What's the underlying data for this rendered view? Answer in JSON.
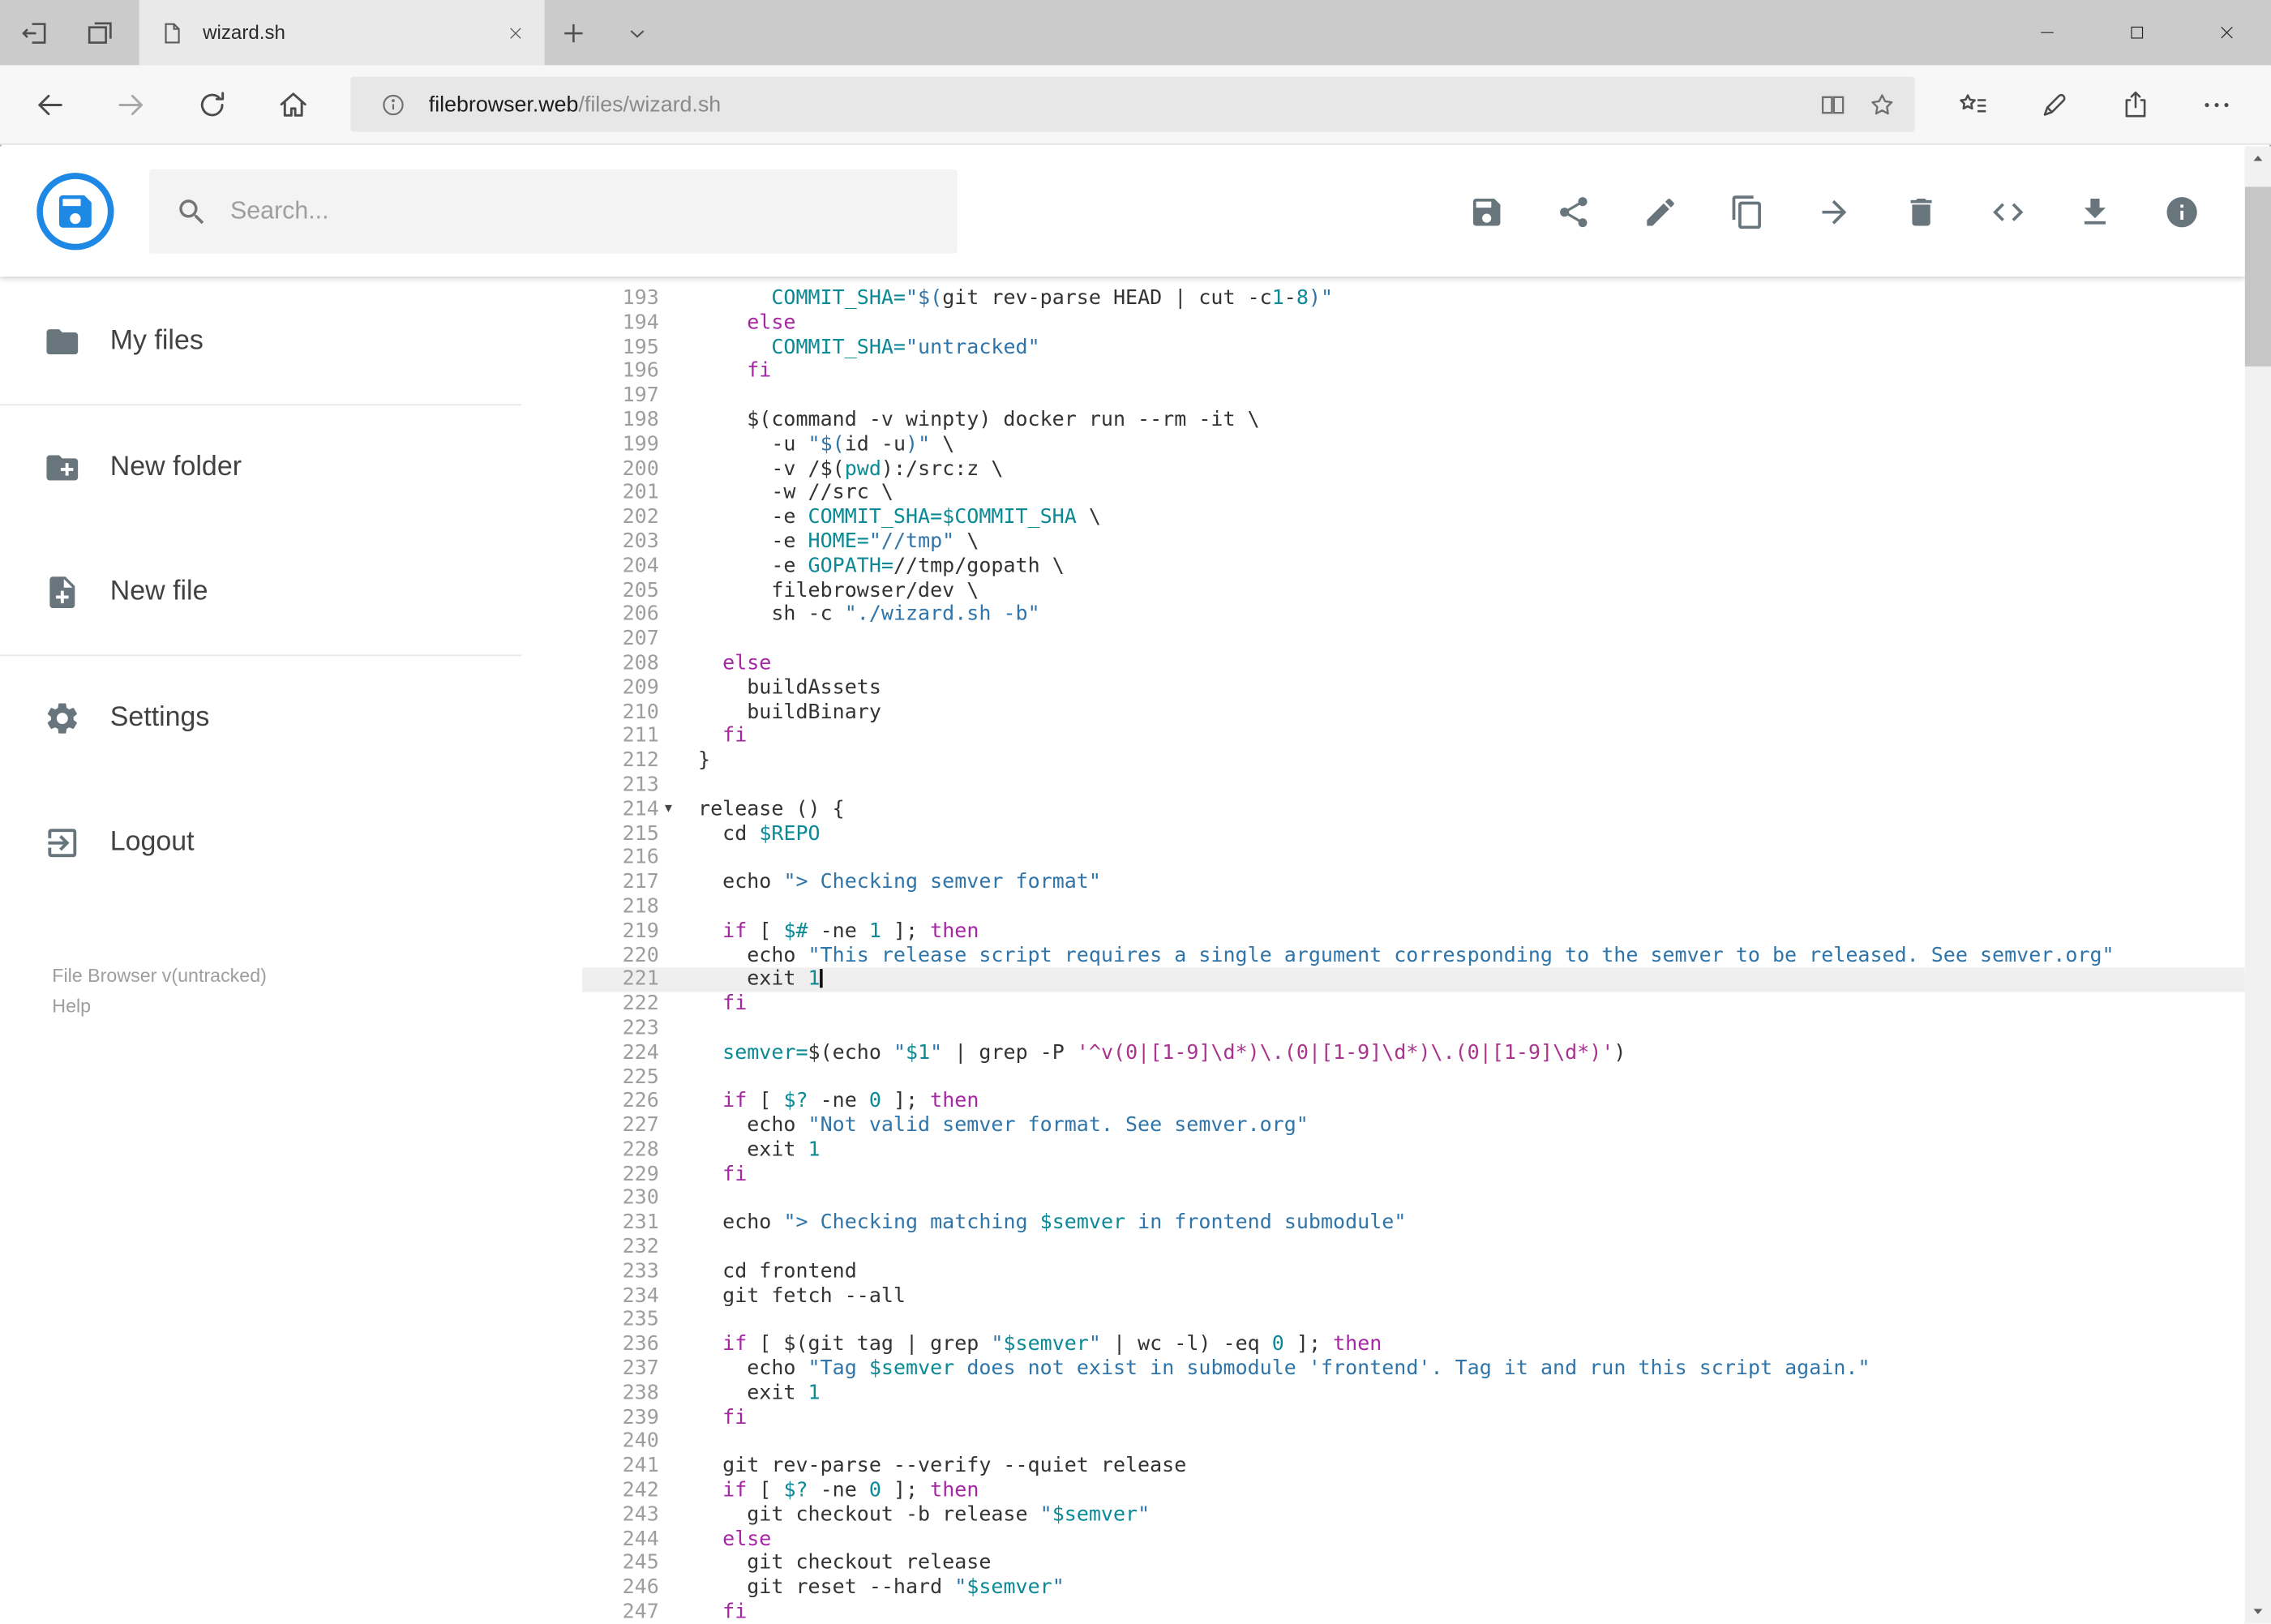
{
  "window": {
    "tab_title": "wizard.sh",
    "control_icons": [
      "minimize-icon",
      "maximize-icon",
      "close-icon"
    ],
    "corner_icons": [
      "set-tabs-aside-icon",
      "tabs-set-aside-icon"
    ],
    "tab_icons": [
      "page-favicon-icon",
      "tab-close-icon",
      "new-tab-icon",
      "tab-preview-chevron-icon"
    ]
  },
  "browser": {
    "url_host": "filebrowser.web",
    "url_path": "/files/wizard.sh",
    "nav_icons": [
      "back-icon",
      "forward-icon",
      "refresh-icon",
      "home-icon"
    ],
    "urlbar_icons": [
      "site-info-icon",
      "reading-view-icon",
      "favorite-star-icon"
    ],
    "action_icons": [
      "hub-icon",
      "web-note-pen-icon",
      "share-icon",
      "more-ellipsis-icon"
    ]
  },
  "header": {
    "search_placeholder": "Search...",
    "action_icons": [
      "save-icon",
      "share-icon",
      "rename-pencil-icon",
      "copy-icon",
      "move-arrow-icon",
      "delete-trash-icon",
      "raw-code-icon",
      "download-icon",
      "info-icon"
    ],
    "logo_icon": "filebrowser-floppy-logo"
  },
  "sidebar": {
    "items": [
      {
        "label": "My files",
        "icon": "folder-icon"
      },
      {
        "label": "New folder",
        "icon": "new-folder-icon"
      },
      {
        "label": "New file",
        "icon": "new-file-icon"
      },
      {
        "label": "Settings",
        "icon": "settings-gear-icon"
      },
      {
        "label": "Logout",
        "icon": "logout-icon"
      }
    ],
    "version": "File Browser v(untracked)",
    "help": "Help"
  },
  "colors": {
    "brand_blue": "#1e88e5",
    "keyword": "#a626a4",
    "string": "#3075a9",
    "regex": "#a8348e",
    "variable": "#0b8a96",
    "number": "#0b8a96",
    "active_line_bg": "#efefef"
  },
  "editor": {
    "language": "shell",
    "first_line": 193,
    "last_line": 247,
    "active_line": 221,
    "fold_line": 214,
    "lines": [
      {
        "n": 193,
        "t": [
          [
            "      ",
            "p"
          ],
          [
            "COMMIT_SHA=",
            "v"
          ],
          [
            "\"$(",
            "s"
          ],
          [
            "git rev-parse HEAD | cut -c",
            "p"
          ],
          [
            "1",
            "n"
          ],
          [
            "-",
            "p"
          ],
          [
            "8",
            "n"
          ],
          [
            ")\"",
            "s"
          ]
        ]
      },
      {
        "n": 194,
        "t": [
          [
            "    ",
            "p"
          ],
          [
            "else",
            "k"
          ]
        ]
      },
      {
        "n": 195,
        "t": [
          [
            "      ",
            "p"
          ],
          [
            "COMMIT_SHA=",
            "v"
          ],
          [
            "\"untracked\"",
            "s"
          ]
        ]
      },
      {
        "n": 196,
        "t": [
          [
            "    ",
            "p"
          ],
          [
            "fi",
            "k"
          ]
        ]
      },
      {
        "n": 197,
        "t": []
      },
      {
        "n": 198,
        "t": [
          [
            "    $(command -v winpty) docker run --rm -it \\",
            "p"
          ]
        ]
      },
      {
        "n": 199,
        "t": [
          [
            "      -u ",
            "p"
          ],
          [
            "\"$(",
            "s"
          ],
          [
            "id -u",
            "p"
          ],
          [
            ")\"",
            "s"
          ],
          [
            " \\",
            "p"
          ]
        ]
      },
      {
        "n": 200,
        "t": [
          [
            "      -v /$(",
            "p"
          ],
          [
            "pwd",
            "v"
          ],
          [
            "):/src:z \\",
            "p"
          ]
        ]
      },
      {
        "n": 201,
        "t": [
          [
            "      -w //src \\",
            "p"
          ]
        ]
      },
      {
        "n": 202,
        "t": [
          [
            "      -e ",
            "p"
          ],
          [
            "COMMIT_SHA=$COMMIT_SHA",
            "v"
          ],
          [
            " \\",
            "p"
          ]
        ]
      },
      {
        "n": 203,
        "t": [
          [
            "      -e ",
            "p"
          ],
          [
            "HOME=",
            "v"
          ],
          [
            "\"//tmp\"",
            "s"
          ],
          [
            " \\",
            "p"
          ]
        ]
      },
      {
        "n": 204,
        "t": [
          [
            "      -e ",
            "p"
          ],
          [
            "GOPATH=",
            "v"
          ],
          [
            "//tmp/gopath \\",
            "p"
          ]
        ]
      },
      {
        "n": 205,
        "t": [
          [
            "      filebrowser/dev \\",
            "p"
          ]
        ]
      },
      {
        "n": 206,
        "t": [
          [
            "      sh -c ",
            "p"
          ],
          [
            "\"./wizard.sh -b\"",
            "s"
          ]
        ]
      },
      {
        "n": 207,
        "t": []
      },
      {
        "n": 208,
        "t": [
          [
            "  ",
            "p"
          ],
          [
            "else",
            "k"
          ]
        ]
      },
      {
        "n": 209,
        "t": [
          [
            "    buildAssets",
            "p"
          ]
        ]
      },
      {
        "n": 210,
        "t": [
          [
            "    buildBinary",
            "p"
          ]
        ]
      },
      {
        "n": 211,
        "t": [
          [
            "  ",
            "p"
          ],
          [
            "fi",
            "k"
          ]
        ]
      },
      {
        "n": 212,
        "t": [
          [
            "}",
            "p"
          ]
        ]
      },
      {
        "n": 213,
        "t": []
      },
      {
        "n": 214,
        "t": [
          [
            "release () {",
            "p"
          ]
        ]
      },
      {
        "n": 215,
        "t": [
          [
            "  cd ",
            "p"
          ],
          [
            "$REPO",
            "v"
          ]
        ]
      },
      {
        "n": 216,
        "t": []
      },
      {
        "n": 217,
        "t": [
          [
            "  echo ",
            "p"
          ],
          [
            "\"> Checking semver format\"",
            "s"
          ]
        ]
      },
      {
        "n": 218,
        "t": []
      },
      {
        "n": 219,
        "t": [
          [
            "  ",
            "p"
          ],
          [
            "if",
            "k"
          ],
          [
            " [ ",
            "p"
          ],
          [
            "$#",
            "v"
          ],
          [
            " -ne ",
            "p"
          ],
          [
            "1",
            "n"
          ],
          [
            " ]; ",
            "p"
          ],
          [
            "then",
            "k"
          ]
        ]
      },
      {
        "n": 220,
        "t": [
          [
            "    echo ",
            "p"
          ],
          [
            "\"This release script requires a single argument corresponding to the semver to be released. See semver.org\"",
            "s"
          ]
        ]
      },
      {
        "n": 221,
        "t": [
          [
            "    exit ",
            "p"
          ],
          [
            "1",
            "n"
          ]
        ]
      },
      {
        "n": 222,
        "t": [
          [
            "  ",
            "p"
          ],
          [
            "fi",
            "k"
          ]
        ]
      },
      {
        "n": 223,
        "t": []
      },
      {
        "n": 224,
        "t": [
          [
            "  ",
            "p"
          ],
          [
            "semver=",
            "v"
          ],
          [
            "$(echo ",
            "p"
          ],
          [
            "\"",
            "s"
          ],
          [
            "$1",
            "v"
          ],
          [
            "\"",
            "s"
          ],
          [
            " | grep -P ",
            "p"
          ],
          [
            "'^v(0|[1-9]\\d*)\\.(0|[1-9]\\d*)\\.(0|[1-9]\\d*)'",
            "r"
          ],
          [
            ")",
            "p"
          ]
        ]
      },
      {
        "n": 225,
        "t": []
      },
      {
        "n": 226,
        "t": [
          [
            "  ",
            "p"
          ],
          [
            "if",
            "k"
          ],
          [
            " [ ",
            "p"
          ],
          [
            "$?",
            "v"
          ],
          [
            " -ne ",
            "p"
          ],
          [
            "0",
            "n"
          ],
          [
            " ]; ",
            "p"
          ],
          [
            "then",
            "k"
          ]
        ]
      },
      {
        "n": 227,
        "t": [
          [
            "    echo ",
            "p"
          ],
          [
            "\"Not valid semver format. See semver.org\"",
            "s"
          ]
        ]
      },
      {
        "n": 228,
        "t": [
          [
            "    exit ",
            "p"
          ],
          [
            "1",
            "n"
          ]
        ]
      },
      {
        "n": 229,
        "t": [
          [
            "  ",
            "p"
          ],
          [
            "fi",
            "k"
          ]
        ]
      },
      {
        "n": 230,
        "t": []
      },
      {
        "n": 231,
        "t": [
          [
            "  echo ",
            "p"
          ],
          [
            "\"> Checking matching ",
            "s"
          ],
          [
            "$semver",
            "v"
          ],
          [
            " in frontend submodule\"",
            "s"
          ]
        ]
      },
      {
        "n": 232,
        "t": []
      },
      {
        "n": 233,
        "t": [
          [
            "  cd frontend",
            "p"
          ]
        ]
      },
      {
        "n": 234,
        "t": [
          [
            "  git fetch --all",
            "p"
          ]
        ]
      },
      {
        "n": 235,
        "t": []
      },
      {
        "n": 236,
        "t": [
          [
            "  ",
            "p"
          ],
          [
            "if",
            "k"
          ],
          [
            " [ $(git tag | grep ",
            "p"
          ],
          [
            "\"",
            "s"
          ],
          [
            "$semver",
            "v"
          ],
          [
            "\"",
            "s"
          ],
          [
            " | wc -l) -eq ",
            "p"
          ],
          [
            "0",
            "n"
          ],
          [
            " ]; ",
            "p"
          ],
          [
            "then",
            "k"
          ]
        ]
      },
      {
        "n": 237,
        "t": [
          [
            "    echo ",
            "p"
          ],
          [
            "\"Tag ",
            "s"
          ],
          [
            "$semver",
            "v"
          ],
          [
            " does not exist in submodule 'frontend'. Tag it and run this script again.\"",
            "s"
          ]
        ]
      },
      {
        "n": 238,
        "t": [
          [
            "    exit ",
            "p"
          ],
          [
            "1",
            "n"
          ]
        ]
      },
      {
        "n": 239,
        "t": [
          [
            "  ",
            "p"
          ],
          [
            "fi",
            "k"
          ]
        ]
      },
      {
        "n": 240,
        "t": []
      },
      {
        "n": 241,
        "t": [
          [
            "  git rev-parse --verify --quiet release",
            "p"
          ]
        ]
      },
      {
        "n": 242,
        "t": [
          [
            "  ",
            "p"
          ],
          [
            "if",
            "k"
          ],
          [
            " [ ",
            "p"
          ],
          [
            "$?",
            "v"
          ],
          [
            " -ne ",
            "p"
          ],
          [
            "0",
            "n"
          ],
          [
            " ]; ",
            "p"
          ],
          [
            "then",
            "k"
          ]
        ]
      },
      {
        "n": 243,
        "t": [
          [
            "    git checkout -b release ",
            "p"
          ],
          [
            "\"",
            "s"
          ],
          [
            "$semver",
            "v"
          ],
          [
            "\"",
            "s"
          ]
        ]
      },
      {
        "n": 244,
        "t": [
          [
            "  ",
            "p"
          ],
          [
            "else",
            "k"
          ]
        ]
      },
      {
        "n": 245,
        "t": [
          [
            "    git checkout release",
            "p"
          ]
        ]
      },
      {
        "n": 246,
        "t": [
          [
            "    git reset --hard ",
            "p"
          ],
          [
            "\"",
            "s"
          ],
          [
            "$semver",
            "v"
          ],
          [
            "\"",
            "s"
          ]
        ]
      },
      {
        "n": 247,
        "t": [
          [
            "  ",
            "p"
          ],
          [
            "fi",
            "k"
          ]
        ]
      }
    ]
  }
}
